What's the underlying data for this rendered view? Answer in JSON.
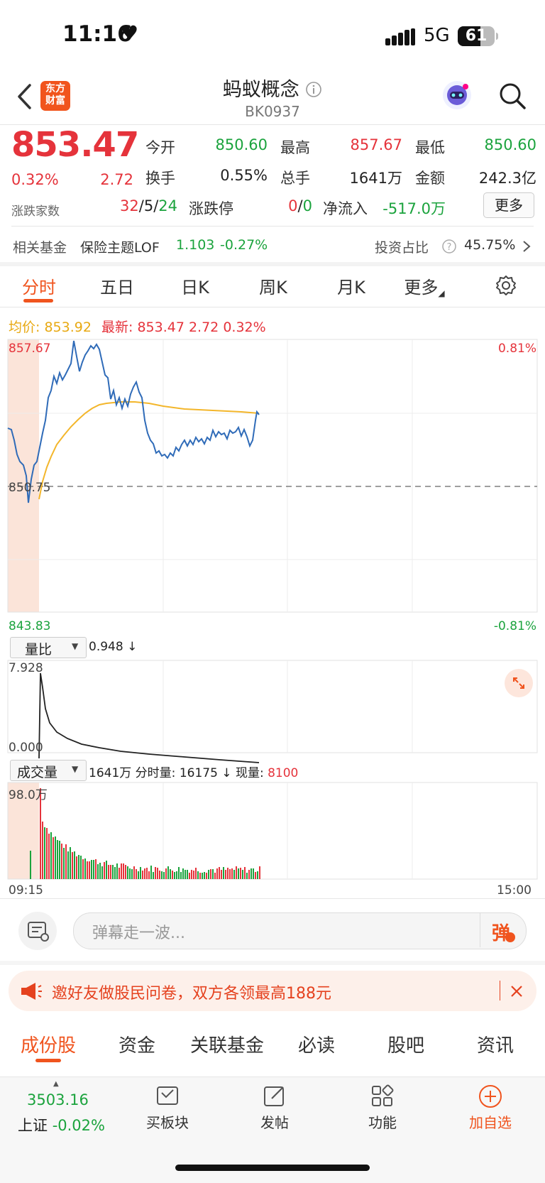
{
  "status": {
    "time": "11:16",
    "network": "5G",
    "battery": "61"
  },
  "header": {
    "title": "蚂蚁概念",
    "code": "BK0937"
  },
  "quote": {
    "price": "853.47",
    "change_pct": "0.32%",
    "change": "2.72",
    "open_label": "今开",
    "open": "850.60",
    "high_label": "最高",
    "high": "857.67",
    "low_label": "最低",
    "low": "850.60",
    "turnover_label": "换手",
    "turnover": "0.55%",
    "volume_label": "总手",
    "volume": "1641万",
    "amount_label": "金额",
    "amount": "242.3亿",
    "breadth_label": "涨跌家数",
    "breadth_up": "32",
    "breadth_flat": "5",
    "breadth_down": "24",
    "limit_label": "涨跌停",
    "limit_up": "0",
    "limit_down": "0",
    "netflow_label": "净流入",
    "netflow": "-517.0万",
    "more_label": "更多"
  },
  "fund": {
    "label": "相关基金",
    "name": "保险主题LOF",
    "price": "1.103",
    "change": "-0.27%",
    "ratio_label": "投资占比",
    "ratio": "45.75%"
  },
  "tabs": [
    "分时",
    "五日",
    "日K",
    "周K",
    "月K",
    "更多"
  ],
  "chart_header": {
    "avg_label": "均价:",
    "avg": "853.92",
    "last_label": "最新:",
    "last": "853.47",
    "last_change": "2.72",
    "last_pct": "0.32%"
  },
  "axes": {
    "price_top": "857.67",
    "price_mid": "850.75",
    "price_bottom": "843.83",
    "pct_top": "0.81%",
    "pct_bottom": "-0.81%",
    "vr_top": "7.928",
    "vr_bottom": "0.000",
    "vol_top": "98.0万",
    "time_start": "09:15",
    "time_end": "15:00"
  },
  "indicator1": {
    "name": "量比",
    "value": "0.948 ↓"
  },
  "indicator2": {
    "name": "成交量",
    "total": "1641万",
    "fs_label": "分时量:",
    "fs_value": "16175 ↓",
    "now_label": "现量:",
    "now_value": "8100"
  },
  "danmu": {
    "placeholder": "弹幕走一波...",
    "button": "弹"
  },
  "banner": {
    "text": "邀好友做股民问卷，双方各领最高188元"
  },
  "bottom_tabs": [
    "成份股",
    "资金",
    "关联基金",
    "必读",
    "股吧",
    "资讯"
  ],
  "dock": {
    "index_value": "3503.16",
    "index_name": "上证",
    "index_change": "-0.02%",
    "buy": "买板块",
    "post": "发帖",
    "func": "功能",
    "watch": "加自选"
  },
  "colors": {
    "up": "#e5333b",
    "down": "#1ba33d",
    "accent": "#f0541e",
    "price_line": "#2f6bb8",
    "avg_line": "#f3b62b"
  }
}
